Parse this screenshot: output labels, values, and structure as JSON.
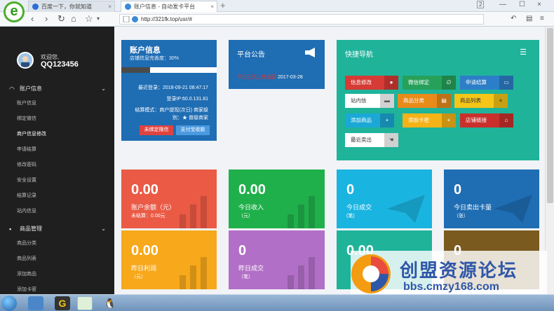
{
  "browser": {
    "tabs": [
      {
        "label": "百度一下，你就知道",
        "close": "×"
      },
      {
        "label": "账户信息 - 自动发卡平台",
        "close": "×"
      }
    ],
    "new_tab": "+",
    "url": "http://321fk.top/usr/#",
    "tab_count": "2",
    "win_controls": [
      "—",
      "☐",
      "×"
    ]
  },
  "sidebar": {
    "welcome": "欢迎您,",
    "username": "QQ123456",
    "sections": [
      {
        "label": "账户信息",
        "icon": "dashboard-icon",
        "items": [
          "账户信息",
          "绑定微信",
          "商户信息修改",
          "申请结算",
          "修改密码",
          "安全设置",
          "结算记录",
          "站内信息"
        ]
      },
      {
        "label": "商品管理",
        "icon": "grid-icon",
        "items": [
          "商品分类",
          "商品列表",
          "添加商品",
          "添加卡密"
        ]
      }
    ],
    "active_item": "商户信息修改"
  },
  "account": {
    "title": "账户信息",
    "subtitle": "店铺信息完善度：30%",
    "progress_pct": 30,
    "last_login": "最近登录：2018-09-21 08:47:17",
    "login_ip": "登录IP:60.0.131.81",
    "settle": "结算模式：商户提现(次日) 商家级",
    "level": "别：★ 普级商家",
    "btn_bind": "未绑定微信",
    "btn_pay": "支付宝收款"
  },
  "notice": {
    "title": "平台公告",
    "item": "平台正式上线运营",
    "date": "2017-03-28"
  },
  "quicknav": {
    "title": "快捷导航",
    "buttons": [
      {
        "label": "信息修改",
        "icon": "user-icon",
        "color": "#d63b35"
      },
      {
        "label": "微信绑定",
        "icon": "link-icon",
        "color": "#27a15a"
      },
      {
        "label": "申请结算",
        "icon": "card-icon",
        "color": "#2d7ec8"
      },
      {
        "label": "站内信",
        "icon": "message-icon",
        "color": "#ffffff"
      },
      {
        "label": "商品分类",
        "icon": "list-icon",
        "color": "#e88b1b"
      },
      {
        "label": "商品列表",
        "icon": "list-icon",
        "color": "#f5c518"
      },
      {
        "label": "添加商品",
        "icon": "plus-icon",
        "color": "#1ba8d6"
      },
      {
        "label": "添加卡密",
        "icon": "plus-icon",
        "color": "#f5b318"
      },
      {
        "label": "店铺链接",
        "icon": "home-icon",
        "color": "#c9302c"
      },
      {
        "label": "最近卖出",
        "icon": "hand-icon",
        "color": "#ffffff"
      }
    ]
  },
  "stats": [
    {
      "value": "0.00",
      "label": "账户余额（元）",
      "sub": "未结算：0.00元",
      "color": "#ea5a45"
    },
    {
      "value": "0.00",
      "label": "今日收入",
      "sub": "（元）",
      "color": "#20b04b"
    },
    {
      "value": "0",
      "label": "今日成交",
      "sub": "(笔)",
      "color": "#1ab4e0"
    },
    {
      "value": "0",
      "label": "今日卖出卡量",
      "sub": "（张）",
      "color": "#1f6db3"
    },
    {
      "value": "0.00",
      "label": "昨日利润",
      "sub": "（元）",
      "color": "#f7a81b"
    },
    {
      "value": "0",
      "label": "昨日成交",
      "sub": "（笔）",
      "color": "#b26fc7"
    },
    {
      "value": "0.00",
      "label": "",
      "sub": "",
      "color": "#1fb39a"
    },
    {
      "value": "0",
      "label": "",
      "sub": "",
      "color": "#7a5a1f"
    }
  ],
  "watermark": {
    "line1": "创盟资源论坛",
    "line2": "bbs.cmzy168.com"
  }
}
